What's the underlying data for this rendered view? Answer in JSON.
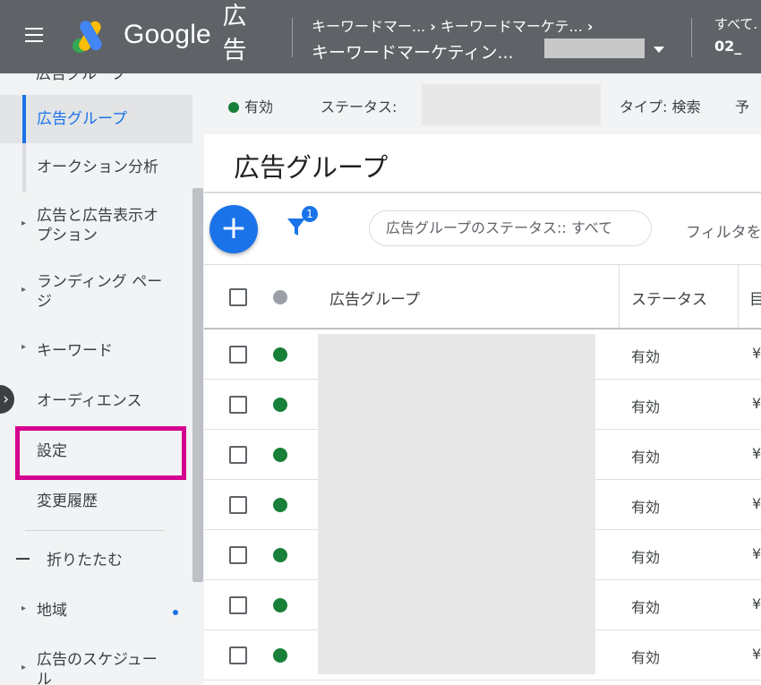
{
  "topbar": {
    "brand": "Google",
    "product": "広告",
    "breadcrumb": [
      "キーワードマー...",
      "キーワードマーケテ...",
      ""
    ],
    "campaign": "キーワードマーケティン...",
    "account_top": "すべて.",
    "account_bottom": "02_"
  },
  "sidebar": {
    "cut_item": "広告グループ",
    "items": [
      {
        "label": "広告グループ"
      },
      {
        "label": "オークション分析"
      },
      {
        "label": "広告と広告表示オプション"
      },
      {
        "label": "ランディング ページ"
      },
      {
        "label": "キーワード"
      },
      {
        "label": "オーディエンス"
      },
      {
        "label": "設定"
      },
      {
        "label": "変更履歴"
      },
      {
        "label": "折りたたむ"
      },
      {
        "label": "地域"
      },
      {
        "label": "広告のスケジュール"
      }
    ]
  },
  "statusbar": {
    "status_value": "有効",
    "status_label": "ステータス:",
    "type": "タイプ: 検索",
    "budget_cut": "予"
  },
  "main": {
    "title": "広告グループ",
    "filter_badge": "1",
    "chip": "広告グループのステータス:: すべて",
    "filter_text": "フィルタを"
  },
  "table": {
    "col_adgroup": "広告グループ",
    "col_status": "ステータス",
    "col_budget_cut": "目",
    "rows": [
      {
        "status": "有効",
        "budget": "¥"
      },
      {
        "status": "有効",
        "budget": "¥"
      },
      {
        "status": "有効",
        "budget": "¥"
      },
      {
        "status": "有効",
        "budget": "¥"
      },
      {
        "status": "有効",
        "budget": "¥"
      },
      {
        "status": "有効",
        "budget": "¥"
      },
      {
        "status": "有効",
        "budget": "¥"
      }
    ]
  },
  "colors": {
    "topbar": "#5f6368",
    "accent": "#1a73e8",
    "enabled": "#188038",
    "highlight": "#d6008f"
  }
}
